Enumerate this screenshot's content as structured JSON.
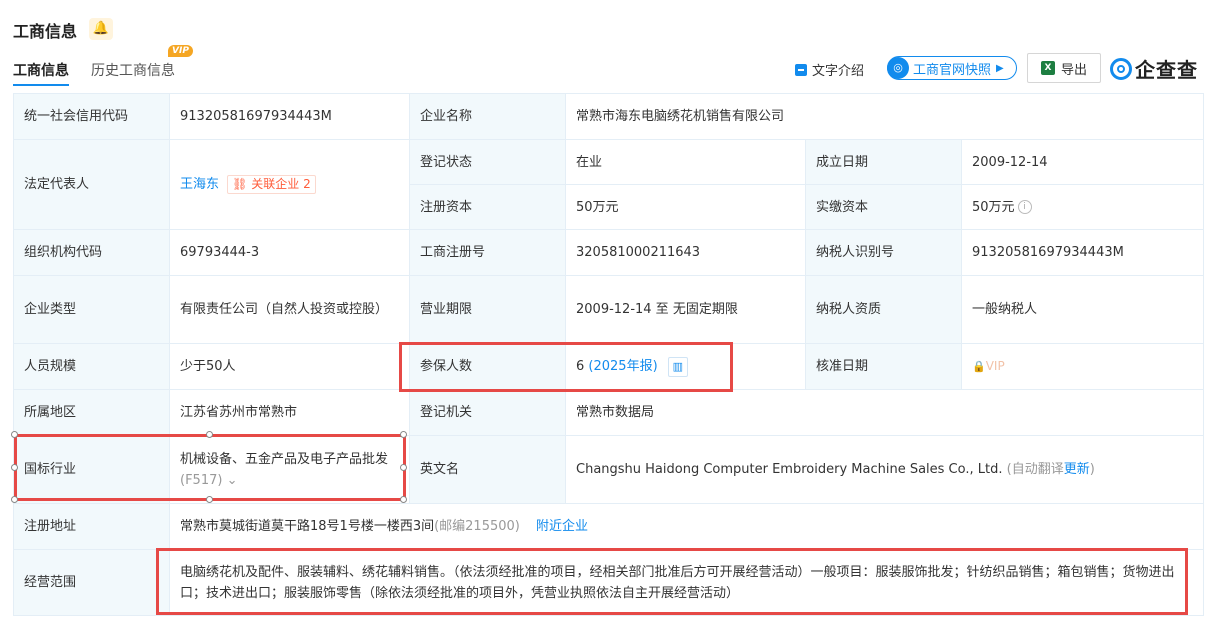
{
  "header": {
    "title": "工商信息",
    "tabs": [
      {
        "label": "工商信息"
      },
      {
        "label": "历史工商信息"
      }
    ],
    "vip_badge": "VIP",
    "text_intro": "文字介绍",
    "snapshot": "工商官网快照",
    "export": "导出",
    "logo": "企查查"
  },
  "rows": {
    "credit_code": {
      "label": "统一社会信用代码",
      "value": "91320581697934443M"
    },
    "company_name": {
      "label": "企业名称",
      "value": "常熟市海东电脑绣花机销售有限公司"
    },
    "legal_rep": {
      "label": "法定代表人",
      "value": "王海东",
      "related_label": "关联企业",
      "related_count": "2"
    },
    "reg_status": {
      "label": "登记状态",
      "value": "在业"
    },
    "found_date": {
      "label": "成立日期",
      "value": "2009-12-14"
    },
    "reg_capital": {
      "label": "注册资本",
      "value": "50万元"
    },
    "paid_capital": {
      "label": "实缴资本",
      "value": "50万元"
    },
    "org_code": {
      "label": "组织机构代码",
      "value": "69793444-3"
    },
    "reg_no": {
      "label": "工商注册号",
      "value": "320581000211643"
    },
    "tax_id": {
      "label": "纳税人识别号",
      "value": "91320581697934443M"
    },
    "company_type": {
      "label": "企业类型",
      "value": "有限责任公司（自然人投资或控股）"
    },
    "business_term": {
      "label": "营业期限",
      "value": "2009-12-14 至 无固定期限"
    },
    "taxpayer_qual": {
      "label": "纳税人资质",
      "value": "一般纳税人"
    },
    "staff_size": {
      "label": "人员规模",
      "value": "少于50人"
    },
    "insured": {
      "label": "参保人数",
      "value": "6",
      "report": "(2025年报)"
    },
    "approve_date": {
      "label": "核准日期",
      "value": "VIP"
    },
    "region": {
      "label": "所属地区",
      "value": "江苏省苏州市常熟市"
    },
    "reg_authority": {
      "label": "登记机关",
      "value": "常熟市数据局"
    },
    "industry": {
      "label": "国标行业",
      "value": "机械设备、五金产品及电子产品批发",
      "code": "(F517)"
    },
    "english_name": {
      "label": "英文名",
      "value": "Changshu Haidong Computer Embroidery Machine Sales Co., Ltd.",
      "auto_prefix": "(自动翻译",
      "update": "更新",
      "auto_suffix": ")"
    },
    "address": {
      "label": "注册地址",
      "value": "常熟市莫城街道莫干路18号1号楼一楼西3间",
      "postcode": "(邮编215500)",
      "nearby": "附近企业"
    },
    "scope": {
      "label": "经营范围",
      "value": "电脑绣花机及配件、服装辅料、绣花辅料销售。（依法须经批准的项目，经相关部门批准后方可开展经营活动）一般项目：服装服饰批发；针纺织品销售；箱包销售；货物进出口；技术进出口；服装服饰零售（除依法须经批准的项目外，凭营业执照依法自主开展经营活动）"
    }
  }
}
